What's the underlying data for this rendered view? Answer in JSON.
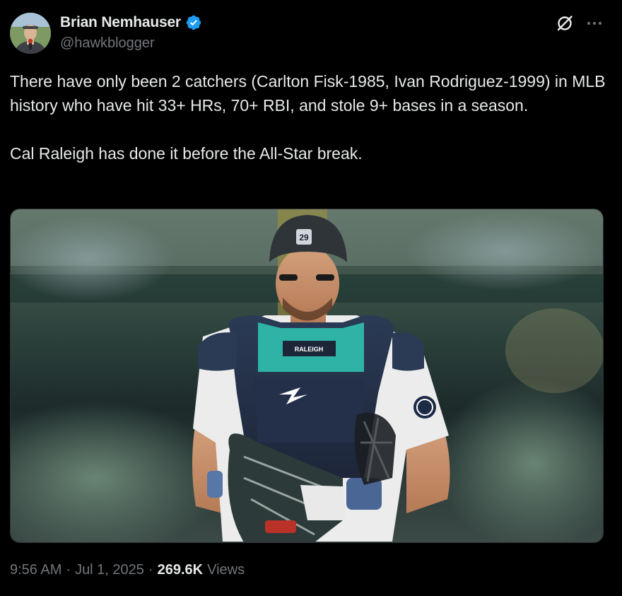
{
  "author": {
    "display_name": "Brian Nemhauser",
    "handle": "@hawkblogger",
    "verified": true,
    "avatar": "profile-photo"
  },
  "colors": {
    "background": "#000000",
    "text_primary": "#e7e9ea",
    "text_secondary": "#71767b",
    "verified_blue": "#1d9bf0"
  },
  "tweet": {
    "text": "There have only been 2 catchers (Carlton Fisk-1985, Ivan Rodriguez-1999) in MLB history who have hit 33+ HRs, 70+ RBI, and stole 9+ bases in a season.\n\nCal Raleigh has done it before the All-Star break.",
    "media": {
      "type": "photo",
      "jersey_name": "RALEIGH",
      "helmet_number": "29"
    }
  },
  "meta": {
    "time": "9:56 AM",
    "separator": "·",
    "date": "Jul 1, 2025",
    "views_count": "269.6K",
    "views_label": "Views"
  },
  "icons": {
    "grok": "grok-icon",
    "more": "more-icon",
    "verified": "verified-badge-icon"
  }
}
